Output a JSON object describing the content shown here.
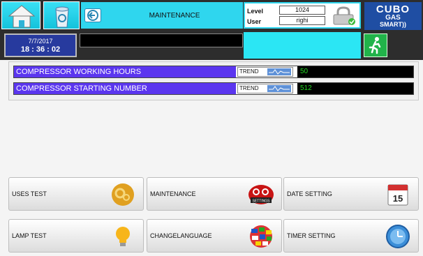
{
  "header": {
    "title": "MAINTENANCE",
    "level_label": "Level",
    "level_value": "1024",
    "user_label": "User",
    "user_value": "righi",
    "logo": {
      "line1": "CUBO",
      "line2": "GAS",
      "line3": "SMART))"
    }
  },
  "status": {
    "date": "7/7/2017",
    "time": "18 : 36 : 02",
    "message": ""
  },
  "parameters": [
    {
      "name": "COMPRESSOR WORKING HOURS",
      "trend_label": "TREND",
      "value": "50"
    },
    {
      "name": "COMPRESSOR STARTING NUMBER",
      "trend_label": "TREND",
      "value": "512"
    }
  ],
  "buttons": {
    "uses_test": "USES TEST",
    "maintenance": "MAINTENANCE",
    "date_setting": "DATE SETTING",
    "lamp_test": "LAMP TEST",
    "change_language_1": "CHANGE",
    "change_language_2": "LANGUAGE",
    "timer_setting": "TIMER SETTING",
    "settings_badge": "SETTINGS",
    "calendar_day": "15"
  },
  "colors": {
    "accent_cyan": "#2fd6ee",
    "param_purple": "#5b36ef",
    "value_green": "#23d923",
    "exit_green": "#21b34a",
    "date_blue": "#273a9e"
  }
}
